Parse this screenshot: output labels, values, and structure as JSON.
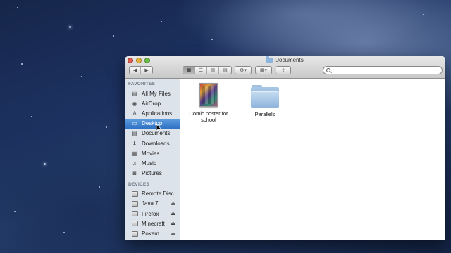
{
  "window": {
    "title": "Documents",
    "title_icon": "folder-icon"
  },
  "toolbar": {
    "back_icon": "back-arrow-icon",
    "forward_icon": "forward-arrow-icon",
    "view_buttons": [
      "icon-view",
      "list-view",
      "column-view",
      "coverflow-view"
    ],
    "action_icon": "gear-icon",
    "arrange_icon": "arrange-grid-icon",
    "share_icon": "share-icon",
    "search_placeholder": ""
  },
  "sidebar": {
    "favorites_heading": "FAVORITES",
    "favorites": [
      {
        "label": "All My Files",
        "icon": "all-files-icon"
      },
      {
        "label": "AirDrop",
        "icon": "airdrop-icon"
      },
      {
        "label": "Applications",
        "icon": "applications-icon"
      },
      {
        "label": "Desktop",
        "icon": "desktop-icon",
        "selected": true
      },
      {
        "label": "Documents",
        "icon": "documents-icon"
      },
      {
        "label": "Downloads",
        "icon": "downloads-icon"
      },
      {
        "label": "Movies",
        "icon": "movies-icon"
      },
      {
        "label": "Music",
        "icon": "music-icon"
      },
      {
        "label": "Pictures",
        "icon": "pictures-icon"
      }
    ],
    "devices_heading": "DEVICES",
    "devices": [
      {
        "label": "Remote Disc",
        "eject": false
      },
      {
        "label": "Java 7…",
        "eject": true
      },
      {
        "label": "Firefox",
        "eject": true
      },
      {
        "label": "Minecraft",
        "eject": true
      },
      {
        "label": "Pokem…",
        "eject": true
      }
    ]
  },
  "files": [
    {
      "name": "Comic poster for school",
      "type": "image"
    },
    {
      "name": "Parallels",
      "type": "folder"
    }
  ],
  "colors": {
    "selection": "#3d80d0",
    "sidebar_bg": "#dde3ea"
  }
}
